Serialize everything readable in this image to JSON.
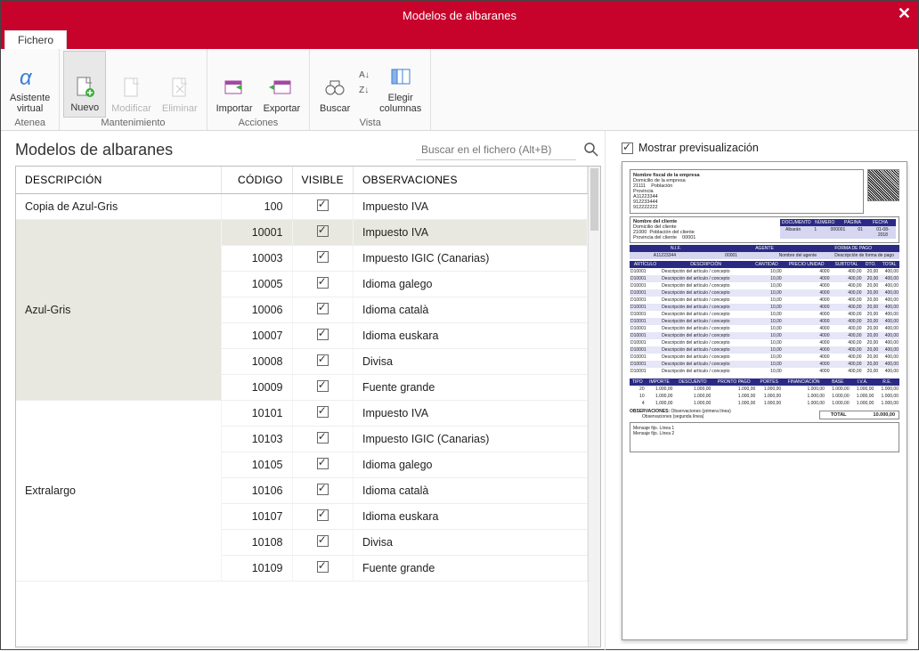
{
  "window": {
    "title": "Modelos de albaranes"
  },
  "tabs": {
    "file": "Fichero"
  },
  "ribbon": {
    "groups": {
      "atenea": {
        "label": "Atenea",
        "buttons": {
          "asistente": "Asistente\nvirtual"
        }
      },
      "mantenimiento": {
        "label": "Mantenimiento",
        "buttons": {
          "nuevo": "Nuevo",
          "modificar": "Modificar",
          "eliminar": "Eliminar"
        }
      },
      "acciones": {
        "label": "Acciones",
        "buttons": {
          "importar": "Importar",
          "exportar": "Exportar"
        }
      },
      "vista": {
        "label": "Vista",
        "buttons": {
          "buscar": "Buscar",
          "elegir": "Elegir\ncolumnas"
        },
        "sort": {
          "az": "A↓Z",
          "za": "Z↓A"
        }
      }
    }
  },
  "list": {
    "title": "Modelos de albaranes",
    "search_placeholder": "Buscar en el fichero (Alt+B)",
    "columns": {
      "desc": "DESCRIPCIÓN",
      "code": "CÓDIGO",
      "visible": "VISIBLE",
      "obs": "OBSERVACIONES"
    },
    "groups": [
      {
        "desc": "Copia de Azul-Gris",
        "rows": [
          {
            "code": "100",
            "visible": true,
            "obs": "Impuesto IVA",
            "selected": false
          }
        ]
      },
      {
        "desc": "Azul-Gris",
        "rows": [
          {
            "code": "10001",
            "visible": true,
            "obs": "Impuesto IVA",
            "selected": true
          },
          {
            "code": "10003",
            "visible": true,
            "obs": "Impuesto IGIC (Canarias)"
          },
          {
            "code": "10005",
            "visible": true,
            "obs": "Idioma galego"
          },
          {
            "code": "10006",
            "visible": true,
            "obs": "Idioma català"
          },
          {
            "code": "10007",
            "visible": true,
            "obs": "Idioma euskara"
          },
          {
            "code": "10008",
            "visible": true,
            "obs": "Divisa"
          },
          {
            "code": "10009",
            "visible": true,
            "obs": "Fuente grande"
          }
        ]
      },
      {
        "desc": "Extralargo",
        "rows": [
          {
            "code": "10101",
            "visible": true,
            "obs": "Impuesto IVA"
          },
          {
            "code": "10103",
            "visible": true,
            "obs": "Impuesto IGIC (Canarias)"
          },
          {
            "code": "10105",
            "visible": true,
            "obs": "Idioma galego"
          },
          {
            "code": "10106",
            "visible": true,
            "obs": "Idioma català"
          },
          {
            "code": "10107",
            "visible": true,
            "obs": "Idioma euskara"
          },
          {
            "code": "10108",
            "visible": true,
            "obs": "Divisa"
          },
          {
            "code": "10109",
            "visible": true,
            "obs": "Fuente grande"
          }
        ]
      }
    ]
  },
  "preview_panel": {
    "checkbox_label": "Mostrar previsualización",
    "checked": true,
    "doc": {
      "company": {
        "name": "Nombre fiscal de la empresa",
        "addr": "Domicilio de la empresa",
        "cp": "21111",
        "pob": "Población",
        "prov": "Provincia",
        "nif": "A11223344",
        "tel1": "912233444",
        "tel2": "912222222"
      },
      "client": {
        "name": "Nombre del cliente",
        "addr": "Domicilio del cliente",
        "cp": "21000",
        "pob": "Población del cliente",
        "prov": "Provincia del cliente",
        "code": "00001"
      },
      "docinfo_headers": [
        "DOCUMENTO",
        "NÚMERO",
        "PÁGINA",
        "FECHA"
      ],
      "docinfo_values": [
        "Albarán",
        "1",
        "000001",
        "01",
        "01-08-2018"
      ],
      "agent_headers": [
        "N.I.F.",
        "AGENTE",
        "FORMA DE PAGO"
      ],
      "agent_values": [
        "A11223344",
        "00001",
        "Nombre del agente",
        "Descripción de forma de pago"
      ],
      "lines_headers": [
        "ARTÍCULO",
        "DESCRIPCIÓN",
        "CANTIDAD",
        "PRECIO UNIDAD",
        "SUBTOTAL",
        "DTO.",
        "TOTAL"
      ],
      "line_sample": {
        "art": "D10001",
        "desc": "Descripción del artículo / concepto",
        "cant": "10,00",
        "pu": "4000",
        "sub": "400,00",
        "dto": "20,00",
        "tot": "400,00"
      },
      "line_count": 15,
      "totals_headers": [
        "TIPO",
        "IMPORTE",
        "DESCUENTO",
        "PRONTO PAGO",
        "PORTES",
        "FINANCIACIÓN",
        "BASE",
        "I.V.A.",
        "R.E."
      ],
      "totals_rows": [
        [
          "20",
          "1.000,00",
          "1.000,00",
          "1.000,00",
          "1.000,00",
          "1.000,00",
          "1.000,00",
          "1.000,00",
          "1.000,00"
        ],
        [
          "10",
          "1.000,00",
          "1.000,00",
          "1.000,00",
          "1.000,00",
          "1.000,00",
          "1.000,00",
          "1.000,00",
          "1.000,00"
        ],
        [
          "4",
          "1.000,00",
          "1.000,00",
          "1.000,00",
          "1.000,00",
          "1.000,00",
          "1.000,00",
          "1.000,00",
          "1.000,00"
        ]
      ],
      "obs_label": "OBSERVACIONES:",
      "obs_lines": [
        "Observaciones (primera línea)",
        "Observaciones (segunda línea)"
      ],
      "total_label": "TOTAL",
      "total_value": "10.000,00",
      "footer_lines": [
        "Mensaje fijo. Línea 1",
        "Mensaje fijo. Línea 2"
      ]
    }
  }
}
